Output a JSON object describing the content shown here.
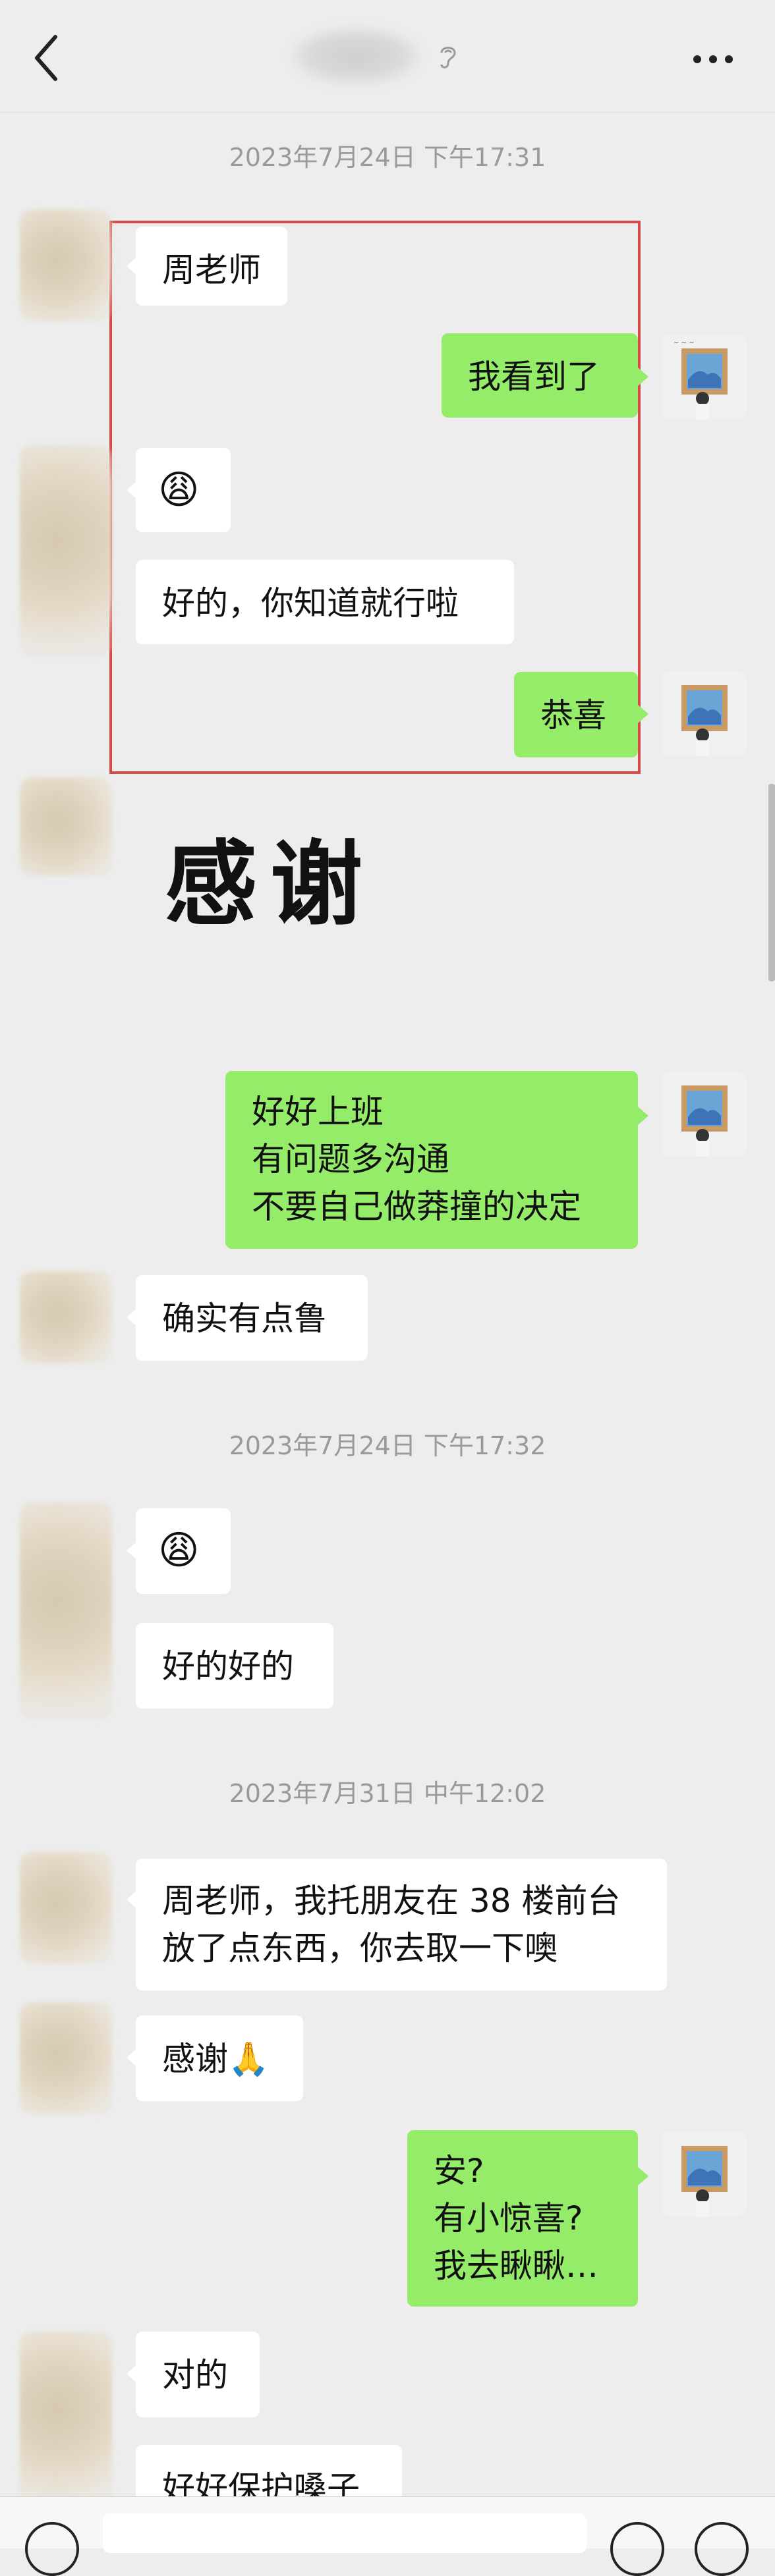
{
  "header": {
    "back_icon": "chevron-left-icon",
    "mute_icon": "ear-icon",
    "more_icon": "more-dots-icon"
  },
  "messages": {
    "t1": "2023年7月24日 下午17:31",
    "m1": "周老师",
    "m2": "我看到了",
    "m3": "😩",
    "m4": "好的，你知道就行啦",
    "m5": "恭喜",
    "sticker": "感谢",
    "m6": "好好上班\n有问题多沟通\n不要自己做莽撞的决定",
    "m7": "确实有点鲁",
    "t2": "2023年7月24日 下午17:32",
    "m8": "😩",
    "m9": "好的好的",
    "t3": "2023年7月31日 中午12:02",
    "m10": "周老师，我托朋友在 38 楼前台\n放了点东西，你去取一下噢",
    "m11": "感谢🙏",
    "m12": "安?\n有小惊喜?\n我去瞅瞅…",
    "m13": "对的",
    "m14": "好好保护嗓子"
  },
  "colors": {
    "sent_bubble": "#95ec69",
    "received_bubble": "#ffffff",
    "highlight_box": "#d84a4a",
    "background": "#ededed"
  }
}
